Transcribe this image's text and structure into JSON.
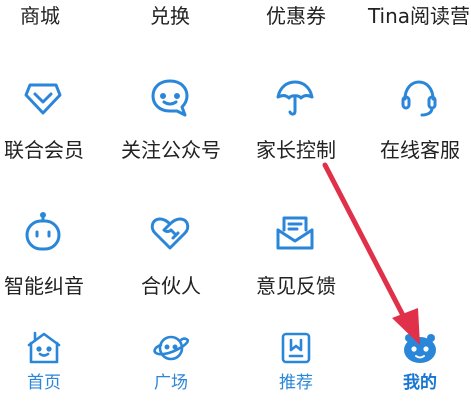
{
  "top_row": {
    "mall_label": "商城",
    "exchange_label": "兑换",
    "coupon_label": "优惠券",
    "reading_camp_label": "Tina阅读营"
  },
  "grid": {
    "joint_member_label": "联合会员",
    "follow_official_label": "关注公众号",
    "parental_control_label": "家长控制",
    "online_service_label": "在线客服",
    "pronunciation_label": "智能纠音",
    "partner_label": "合伙人",
    "feedback_label": "意见反馈"
  },
  "bottom_nav": {
    "home_label": "首页",
    "plaza_label": "广场",
    "recommend_label": "推荐",
    "mine_label": "我的"
  },
  "colors": {
    "accent": "#2a86d8",
    "active": "#1976d2",
    "arrow": "#e0304a",
    "text": "#222222"
  }
}
